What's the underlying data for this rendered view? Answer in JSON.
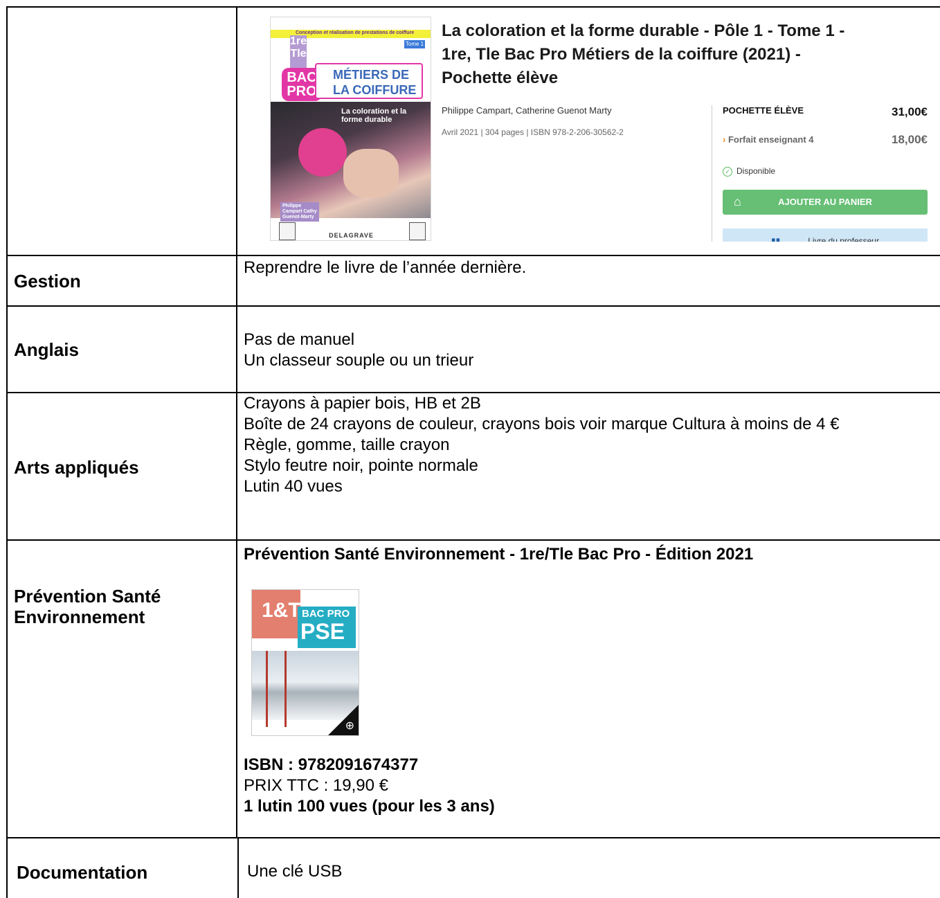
{
  "product": {
    "title_line1": "La coloration et la forme durable - Pôle 1 - Tome 1 -",
    "title_line2": "1re, Tle Bac Pro Métiers de la coiffure (2021) -",
    "title_line3": "Pochette élève",
    "authors": "Philippe Campart, Catherine Guenot Marty",
    "meta": "Avril 2021 | 304 pages | ISBN 978-2-206-30562-2",
    "option1_label": "POCHETTE ÉLÈVE",
    "option1_price": "31,00€",
    "option2_label": "Forfait enseignant 4",
    "option2_price": "18,00€",
    "availability": "Disponible",
    "cart_button": "AJOUTER AU PANIER",
    "teacher_button": "Livre du professeur",
    "cover": {
      "topbar": "Conception et réalisation de prestations de coiffure",
      "tome": "Tome 1",
      "grade": "1re Tle",
      "bac": "BAC PRO",
      "metiers": "MÉTIERS DE LA COIFFURE",
      "subtitle": "La coloration et la forme durable",
      "authors": "Philippe Campart Cathy Guenot-Marty",
      "publisher": "DELAGRAVE"
    }
  },
  "rows": [
    {
      "subject": "Gestion",
      "lines": [
        "Reprendre le livre de l’année dernière."
      ]
    },
    {
      "subject": "Anglais",
      "lines": [
        "Pas de manuel",
        "Un classeur souple ou un trieur"
      ]
    },
    {
      "subject": "Arts appliqués",
      "lines": [
        "Crayons à papier bois, HB et 2B",
        "Boîte de 24 crayons de couleur, crayons bois voir marque Cultura à moins de 4 €",
        "Règle, gomme, taille crayon",
        "Stylo feutre noir, pointe normale",
        "Lutin 40 vues"
      ]
    },
    {
      "subject_line1": "Prévention Santé",
      "subject_line2": "Environnement",
      "title": "Prévention Santé Environnement - 1re/Tle Bac Pro - Édition 2021",
      "isbn": "ISBN : 9782091674377",
      "price": "PRIX TTC : 19,90 €",
      "lutin": "1 lutin 100 vues (pour les 3 ans)",
      "cover": {
        "grade": "1&T",
        "bac": "BAC PRO",
        "pse": "PSE"
      }
    },
    {
      "subject": "Documentation",
      "lines": [
        "Une clé USB"
      ]
    }
  ]
}
